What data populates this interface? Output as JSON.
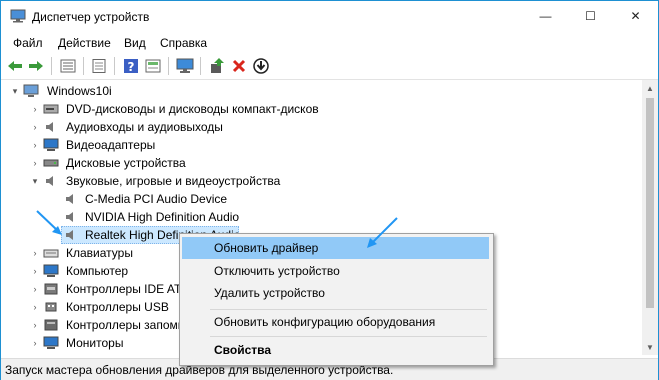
{
  "window": {
    "title": "Диспетчер устройств",
    "minimize": "—",
    "maximize": "☐",
    "close": "✕"
  },
  "menu": [
    "Файл",
    "Действие",
    "Вид",
    "Справка"
  ],
  "toolbar": [
    "back-icon",
    "forward-icon",
    "properties-icon",
    "help-icon",
    "refresh-icon",
    "scan-icon",
    "update-driver-icon",
    "uninstall-icon",
    "disable-icon"
  ],
  "tree": {
    "root": "Windows10i",
    "items": [
      {
        "label": "DVD-дисководы и дисководы компакт-дисков",
        "icon": "dvd-icon"
      },
      {
        "label": "Аудиовходы и аудиовыходы",
        "icon": "audio-io-icon"
      },
      {
        "label": "Видеоадаптеры",
        "icon": "display-adapter-icon"
      },
      {
        "label": "Дисковые устройства",
        "icon": "disk-icon"
      },
      {
        "label": "Звуковые, игровые и видеоустройства",
        "icon": "sound-icon",
        "expanded": true
      },
      {
        "label": "C-Media PCI Audio Device",
        "icon": "speaker-icon",
        "child": true
      },
      {
        "label": "NVIDIA High Definition Audio",
        "icon": "speaker-icon",
        "child": true
      },
      {
        "label": "Realtek High Definition Audio",
        "icon": "speaker-icon",
        "child": true,
        "selected": true
      },
      {
        "label": "Клавиатуры",
        "icon": "keyboard-icon"
      },
      {
        "label": "Компьютер",
        "icon": "computer-icon"
      },
      {
        "label": "Контроллеры IDE ATA/ATAPI",
        "icon": "ide-icon"
      },
      {
        "label": "Контроллеры USB",
        "icon": "usb-icon"
      },
      {
        "label": "Контроллеры запоминающих устройств",
        "icon": "storage-icon"
      },
      {
        "label": "Мониторы",
        "icon": "monitor-icon"
      }
    ]
  },
  "context_menu": {
    "update": "Обновить драйвер",
    "disable": "Отключить устройство",
    "uninstall": "Удалить устройство",
    "scan": "Обновить конфигурацию оборудования",
    "properties": "Свойства"
  },
  "status": "Запуск мастера обновления драйверов для выделенного устройства.",
  "colors": {
    "accent": "#1e90d2",
    "highlight": "#91c9f7",
    "selected": "#cce8ff",
    "annotation": "#2196f3"
  }
}
